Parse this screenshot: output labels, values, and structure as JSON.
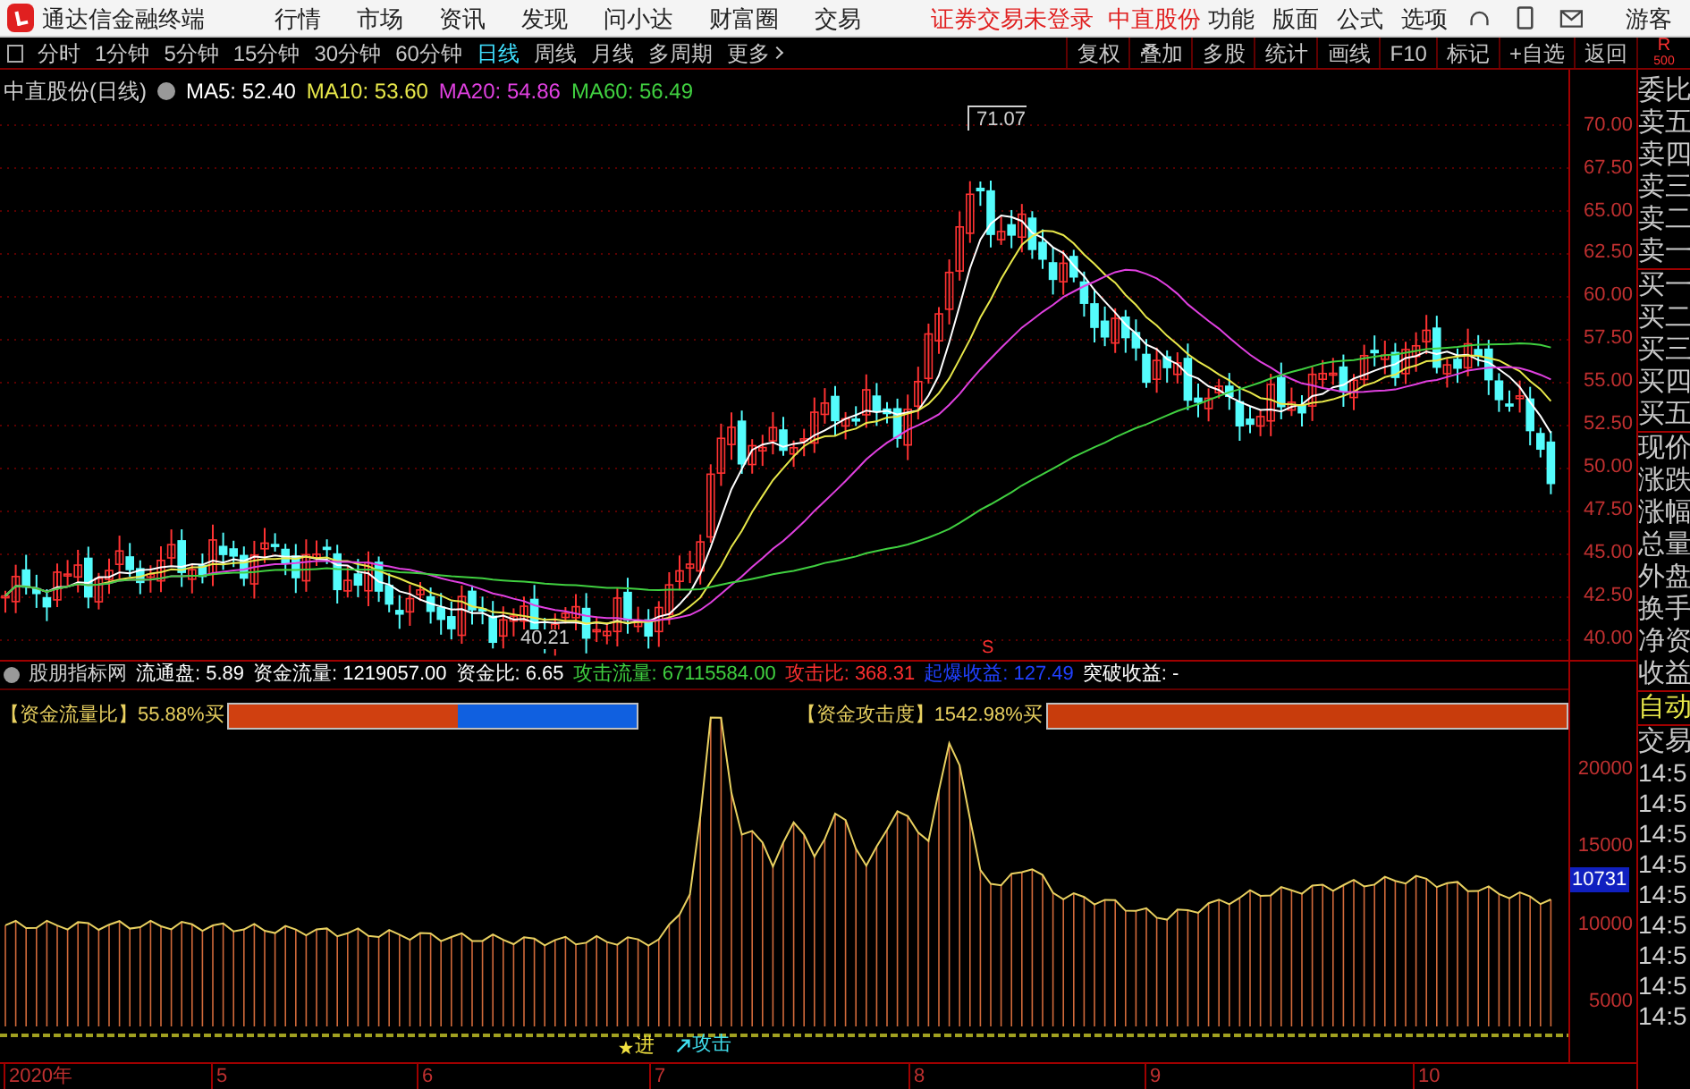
{
  "app": {
    "title": "通达信金融终端"
  },
  "menu": [
    "行情",
    "市场",
    "资讯",
    "发现",
    "问小达",
    "财富圈",
    "交易"
  ],
  "login_status": "证券交易未登录",
  "stock_name": "中直股份",
  "right_menu": [
    "功能",
    "版面",
    "公式",
    "选项"
  ],
  "user": "游客",
  "periods": [
    {
      "label": "分时",
      "selected": false
    },
    {
      "label": "1分钟",
      "selected": false
    },
    {
      "label": "5分钟",
      "selected": false
    },
    {
      "label": "15分钟",
      "selected": false
    },
    {
      "label": "30分钟",
      "selected": false
    },
    {
      "label": "60分钟",
      "selected": false
    },
    {
      "label": "日线",
      "selected": true
    },
    {
      "label": "周线",
      "selected": false
    },
    {
      "label": "月线",
      "selected": false
    },
    {
      "label": "多周期",
      "selected": false
    }
  ],
  "more": "更多",
  "tools": [
    "复权",
    "叠加",
    "多股",
    "统计",
    "画线",
    "F10",
    "标记",
    "+自选",
    "返回"
  ],
  "corner": [
    "R",
    "500"
  ],
  "chart": {
    "title": "中直股份(日线)",
    "ma": [
      {
        "label": "MA5: 52.40",
        "color": "#ffffff"
      },
      {
        "label": "MA10: 53.60",
        "color": "#e8e84a"
      },
      {
        "label": "MA20: 54.86",
        "color": "#e040e0"
      },
      {
        "label": "MA60: 56.49",
        "color": "#40d040"
      }
    ],
    "price_ticks": [
      "70.00",
      "67.50",
      "65.00",
      "62.50",
      "60.00",
      "57.50",
      "55.00",
      "52.50",
      "50.00",
      "47.50",
      "45.00",
      "42.50",
      "40.00"
    ],
    "high_label": "71.07",
    "low_label": "40.21",
    "signal": "S"
  },
  "indicator": {
    "name": "股朋指标网",
    "readouts": [
      {
        "text": "流通盘: 5.89",
        "color": "#ffffff"
      },
      {
        "text": "资金流量: 1219057.00",
        "color": "#ffffff"
      },
      {
        "text": "资金比: 6.65",
        "color": "#ffffff"
      },
      {
        "text": "攻击流量: 67115584.00",
        "color": "#40d040"
      },
      {
        "text": "攻击比: 368.31",
        "color": "#ff3030"
      },
      {
        "text": "起爆收益: 127.49",
        "color": "#2040ff"
      },
      {
        "text": "突破收益: -",
        "color": "#ffffff"
      }
    ],
    "flow_bar": {
      "label": "【资金流量比】",
      "value": "55.88%买",
      "level": 0.56
    },
    "attack_bar": {
      "label": "【资金攻击度】",
      "value": "1542.98%买"
    },
    "ticks": [
      "20000",
      "15000",
      "10000",
      "5000"
    ],
    "current": "10731",
    "markers": [
      "进",
      "攻击"
    ]
  },
  "dates": [
    "2020年",
    "5",
    "6",
    "7",
    "8",
    "9",
    "10"
  ],
  "quote_panel": {
    "fields": [
      "委比",
      "卖五",
      "卖四",
      "卖三",
      "卖二",
      "卖一",
      "买一",
      "买二",
      "买三",
      "买四",
      "买五",
      "现价",
      "涨跌",
      "涨幅",
      "总量",
      "外盘",
      "换手",
      "净资",
      "收益"
    ],
    "tabs": [
      {
        "label": "自动",
        "selected": true
      },
      {
        "label": "交易",
        "selected": false
      }
    ],
    "times": [
      "14:5",
      "14:5",
      "14:5",
      "14:5",
      "14:5",
      "14:5",
      "14:5",
      "14:5",
      "14:5"
    ]
  }
}
